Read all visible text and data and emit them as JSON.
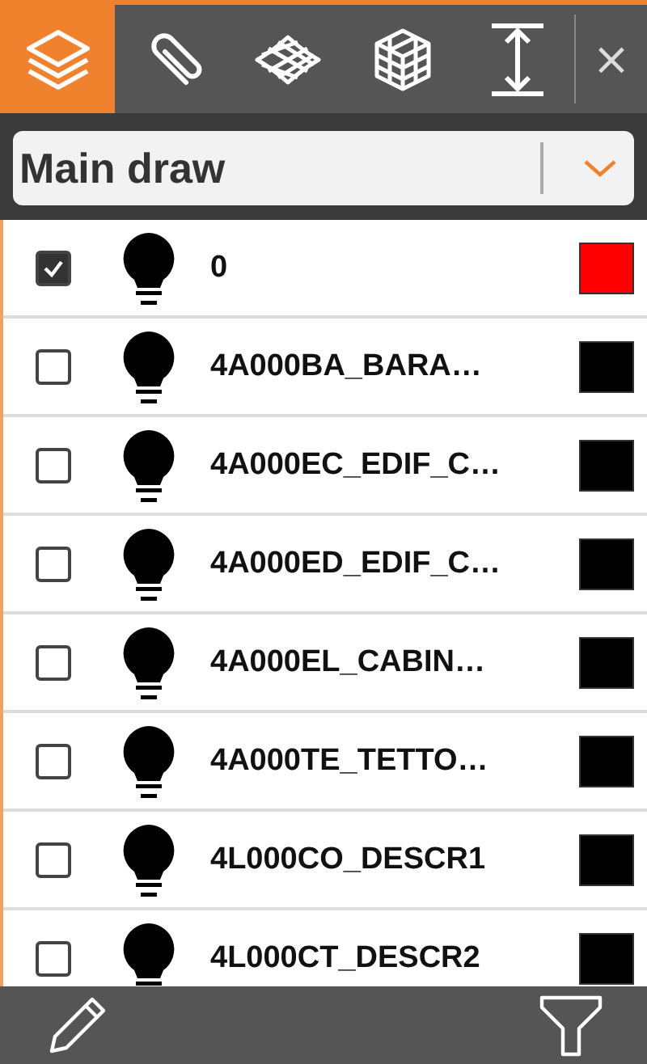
{
  "tabs": [
    {
      "kind": "layers",
      "selected": true
    },
    {
      "kind": "clip",
      "selected": false
    },
    {
      "kind": "surface",
      "selected": false
    },
    {
      "kind": "grid3d",
      "selected": false
    },
    {
      "kind": "height",
      "selected": false
    }
  ],
  "close": "×",
  "drawing_select": {
    "value": "Main draw"
  },
  "layers": [
    {
      "name": "0",
      "checked": true,
      "color": "#ff0000"
    },
    {
      "name": "4A000BA_BARA…",
      "checked": false,
      "color": "#000000"
    },
    {
      "name": "4A000EC_EDIF_C…",
      "checked": false,
      "color": "#000000"
    },
    {
      "name": "4A000ED_EDIF_C…",
      "checked": false,
      "color": "#000000"
    },
    {
      "name": "4A000EL_CABIN…",
      "checked": false,
      "color": "#000000"
    },
    {
      "name": "4A000TE_TETTO…",
      "checked": false,
      "color": "#000000"
    },
    {
      "name": "4L000CO_DESCR1",
      "checked": false,
      "color": "#000000"
    },
    {
      "name": "4L000CT_DESCR2",
      "checked": false,
      "color": "#000000"
    }
  ]
}
